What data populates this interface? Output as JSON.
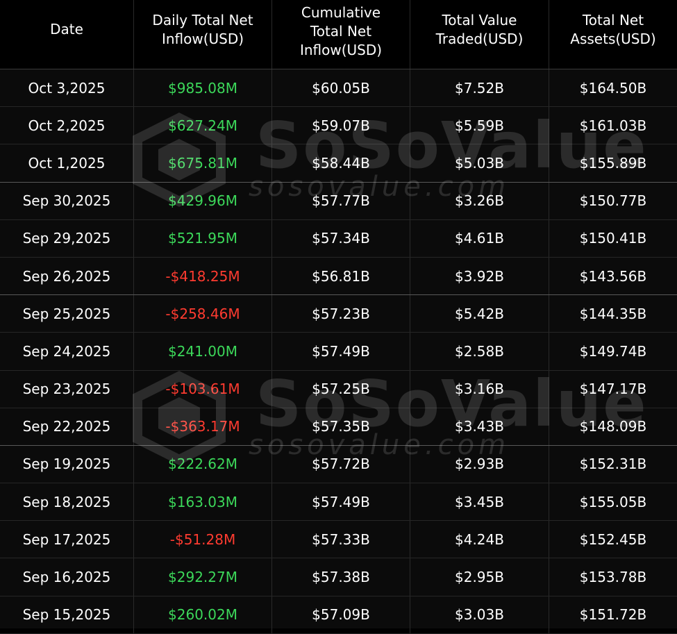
{
  "table": {
    "headers": [
      "Date",
      "Daily Total Net\nInflow(USD)",
      "Cumulative\nTotal Net\nInflow(USD)",
      "Total Value\nTraded(USD)",
      "Total Net\nAssets(USD)"
    ],
    "rows": [
      {
        "date": "Oct 3,2025",
        "daily": "$985.08M",
        "sign": "pos",
        "cumulative": "$60.05B",
        "traded": "$7.52B",
        "assets": "$164.50B"
      },
      {
        "date": "Oct 2,2025",
        "daily": "$627.24M",
        "sign": "pos",
        "cumulative": "$59.07B",
        "traded": "$5.59B",
        "assets": "$161.03B"
      },
      {
        "date": "Oct 1,2025",
        "daily": "$675.81M",
        "sign": "pos",
        "cumulative": "$58.44B",
        "traded": "$5.03B",
        "assets": "$155.89B"
      },
      {
        "date": "Sep 30,2025",
        "daily": "$429.96M",
        "sign": "pos",
        "cumulative": "$57.77B",
        "traded": "$3.26B",
        "assets": "$150.77B"
      },
      {
        "date": "Sep 29,2025",
        "daily": "$521.95M",
        "sign": "pos",
        "cumulative": "$57.34B",
        "traded": "$4.61B",
        "assets": "$150.41B"
      },
      {
        "date": "Sep 26,2025",
        "daily": "-$418.25M",
        "sign": "neg",
        "cumulative": "$56.81B",
        "traded": "$3.92B",
        "assets": "$143.56B"
      },
      {
        "date": "Sep 25,2025",
        "daily": "-$258.46M",
        "sign": "neg",
        "cumulative": "$57.23B",
        "traded": "$5.42B",
        "assets": "$144.35B"
      },
      {
        "date": "Sep 24,2025",
        "daily": "$241.00M",
        "sign": "pos",
        "cumulative": "$57.49B",
        "traded": "$2.58B",
        "assets": "$149.74B"
      },
      {
        "date": "Sep 23,2025",
        "daily": "-$103.61M",
        "sign": "neg",
        "cumulative": "$57.25B",
        "traded": "$3.16B",
        "assets": "$147.17B"
      },
      {
        "date": "Sep 22,2025",
        "daily": "-$363.17M",
        "sign": "neg",
        "cumulative": "$57.35B",
        "traded": "$3.43B",
        "assets": "$148.09B"
      },
      {
        "date": "Sep 19,2025",
        "daily": "$222.62M",
        "sign": "pos",
        "cumulative": "$57.72B",
        "traded": "$2.93B",
        "assets": "$152.31B"
      },
      {
        "date": "Sep 18,2025",
        "daily": "$163.03M",
        "sign": "pos",
        "cumulative": "$57.49B",
        "traded": "$3.45B",
        "assets": "$155.05B"
      },
      {
        "date": "Sep 17,2025",
        "daily": "-$51.28M",
        "sign": "neg",
        "cumulative": "$57.33B",
        "traded": "$4.24B",
        "assets": "$152.45B"
      },
      {
        "date": "Sep 16,2025",
        "daily": "$292.27M",
        "sign": "pos",
        "cumulative": "$57.38B",
        "traded": "$2.95B",
        "assets": "$153.78B"
      },
      {
        "date": "Sep 15,2025",
        "daily": "$260.02M",
        "sign": "pos",
        "cumulative": "$57.09B",
        "traded": "$3.03B",
        "assets": "$151.72B"
      }
    ]
  },
  "watermark": {
    "brand": "SoSoValue",
    "site": "sosovalue.com",
    "icon": "sosovalue-logo-icon"
  },
  "colors": {
    "positive": "#3cd85a",
    "negative": "#ff3b30",
    "background": "#000000",
    "text": "#ffffff"
  }
}
